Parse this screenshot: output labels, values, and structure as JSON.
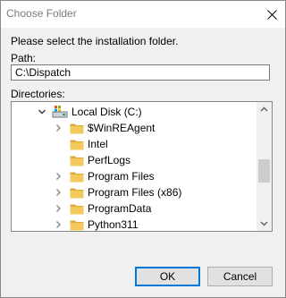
{
  "window": {
    "title": "Choose Folder"
  },
  "prompt": "Please select the installation folder.",
  "path": {
    "label": "Path:",
    "value": "C:\\Dispatch"
  },
  "directories": {
    "label": "Directories:",
    "root": {
      "label": "Local Disk (C:)",
      "icon": "drive-icon",
      "expanded": true
    },
    "items": [
      {
        "label": "$WinREAgent",
        "has_children": true
      },
      {
        "label": "Intel",
        "has_children": false
      },
      {
        "label": "PerfLogs",
        "has_children": false
      },
      {
        "label": "Program Files",
        "has_children": true
      },
      {
        "label": "Program Files (x86)",
        "has_children": true
      },
      {
        "label": "ProgramData",
        "has_children": true
      },
      {
        "label": "Python311",
        "has_children": true
      }
    ]
  },
  "buttons": {
    "ok": "OK",
    "cancel": "Cancel"
  },
  "colors": {
    "folder": "#f3c95b",
    "folder_dark": "#dcab38",
    "accent": "#0078d7"
  }
}
